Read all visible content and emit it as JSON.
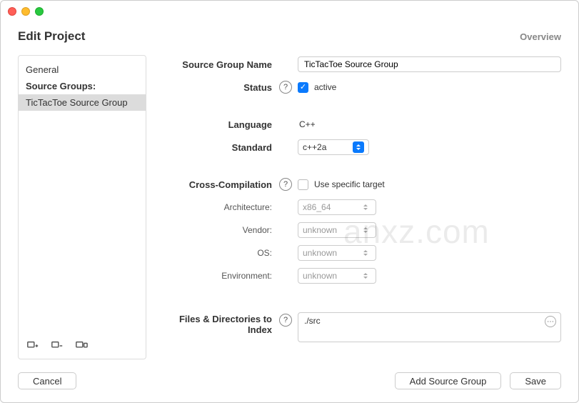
{
  "header": {
    "title": "Edit Project",
    "overview": "Overview"
  },
  "sidebar": {
    "items": [
      {
        "label": "General",
        "header": false,
        "selected": false
      },
      {
        "label": "Source Groups:",
        "header": true,
        "selected": false
      },
      {
        "label": "TicTacToe Source Group",
        "header": false,
        "selected": true
      }
    ]
  },
  "form": {
    "source_group_name_label": "Source Group Name",
    "source_group_name_value": "TicTacToe Source Group",
    "status_label": "Status",
    "status_active_label": "active",
    "status_active_checked": true,
    "language_label": "Language",
    "language_value": "C++",
    "standard_label": "Standard",
    "standard_value": "c++2a",
    "cross_compilation_label": "Cross-Compilation",
    "use_specific_target_label": "Use specific target",
    "use_specific_target_checked": false,
    "architecture_label": "Architecture:",
    "architecture_value": "x86_64",
    "vendor_label": "Vendor:",
    "vendor_value": "unknown",
    "os_label": "OS:",
    "os_value": "unknown",
    "environment_label": "Environment:",
    "environment_value": "unknown",
    "files_dirs_label": "Files & Directories to Index",
    "files_dirs_value": "./src"
  },
  "footer": {
    "cancel": "Cancel",
    "add_source_group": "Add Source Group",
    "save": "Save"
  },
  "watermark": "anxz.com"
}
